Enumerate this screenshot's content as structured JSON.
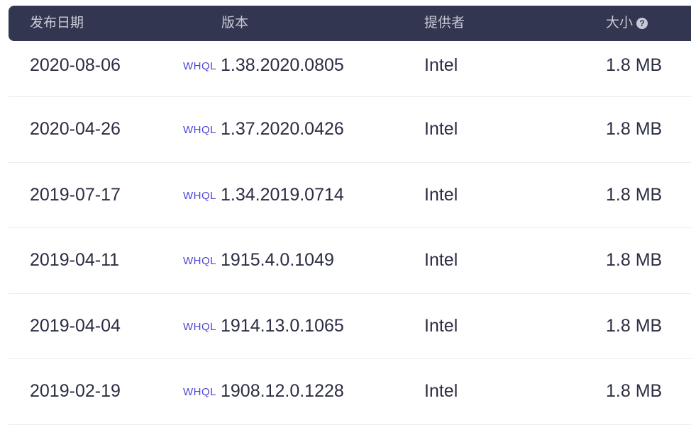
{
  "header": {
    "date": "发布日期",
    "version": "版本",
    "provider": "提供者",
    "size": "大小",
    "size_help_icon": "question-circle-icon"
  },
  "rows": [
    {
      "date": "2020-08-06",
      "badge": "WHQL",
      "version": "1.38.2020.0805",
      "provider": "Intel",
      "size": "1.8 MB"
    },
    {
      "date": "2020-04-26",
      "badge": "WHQL",
      "version": "1.37.2020.0426",
      "provider": "Intel",
      "size": "1.8 MB"
    },
    {
      "date": "2019-07-17",
      "badge": "WHQL",
      "version": "1.34.2019.0714",
      "provider": "Intel",
      "size": "1.8 MB"
    },
    {
      "date": "2019-04-11",
      "badge": "WHQL",
      "version": "1915.4.0.1049",
      "provider": "Intel",
      "size": "1.8 MB"
    },
    {
      "date": "2019-04-04",
      "badge": "WHQL",
      "version": "1914.13.0.1065",
      "provider": "Intel",
      "size": "1.8 MB"
    },
    {
      "date": "2019-02-19",
      "badge": "WHQL",
      "version": "1908.12.0.1228",
      "provider": "Intel",
      "size": "1.8 MB"
    }
  ],
  "colors": {
    "header_bg": "#323650",
    "header_text": "#c7cad6",
    "whql": "#4c46d6",
    "row_text": "#2b2d42",
    "divider": "#ececf0"
  }
}
